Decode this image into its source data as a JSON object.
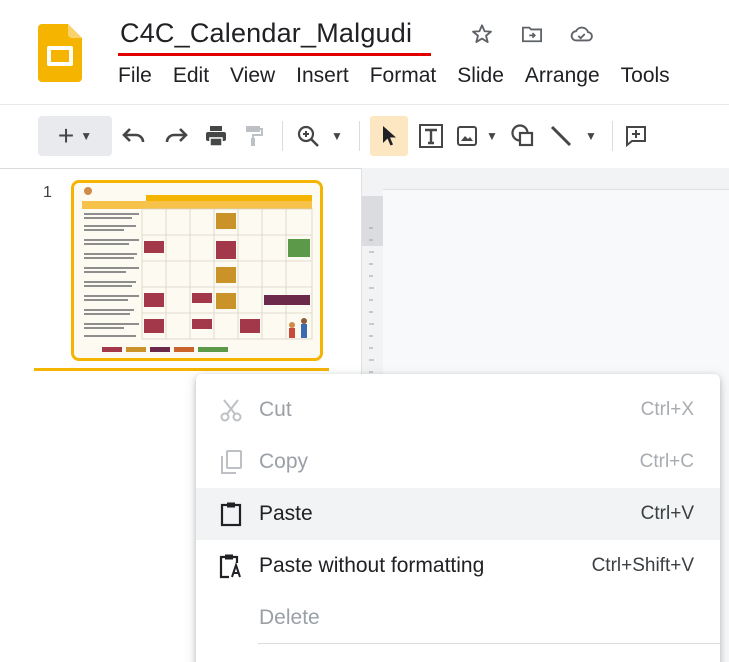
{
  "header": {
    "title": "C4C_Calendar_Malgudi",
    "icons": [
      "star-icon",
      "move-to-folder-icon",
      "cloud-saved-icon"
    ]
  },
  "menubar": {
    "items": [
      "File",
      "Edit",
      "View",
      "Insert",
      "Format",
      "Slide",
      "Arrange",
      "Tools"
    ]
  },
  "toolbar": {
    "icons": [
      "new-slide-icon",
      "undo-icon",
      "redo-icon",
      "print-icon",
      "paint-format-icon",
      "zoom-icon",
      "select-icon",
      "text-box-icon",
      "image-icon",
      "shape-icon",
      "line-icon",
      "comment-icon"
    ]
  },
  "filmstrip": {
    "slides": [
      {
        "number": "1"
      }
    ]
  },
  "context_menu": {
    "items": [
      {
        "label": "Cut",
        "shortcut": "Ctrl+X",
        "icon": "scissors-icon",
        "disabled": true
      },
      {
        "label": "Copy",
        "shortcut": "Ctrl+C",
        "icon": "copy-icon",
        "disabled": true
      },
      {
        "label": "Paste",
        "shortcut": "Ctrl+V",
        "icon": "clipboard-icon",
        "disabled": false
      },
      {
        "label": "Paste without formatting",
        "shortcut": "Ctrl+Shift+V",
        "icon": "paste-plain-icon",
        "disabled": false
      },
      {
        "label": "Delete",
        "shortcut": "",
        "icon": "",
        "disabled": true
      }
    ]
  },
  "colors": {
    "accent": "#f4b400",
    "title_underline": "#e00000",
    "menu_hover": "#f1f3f4"
  }
}
